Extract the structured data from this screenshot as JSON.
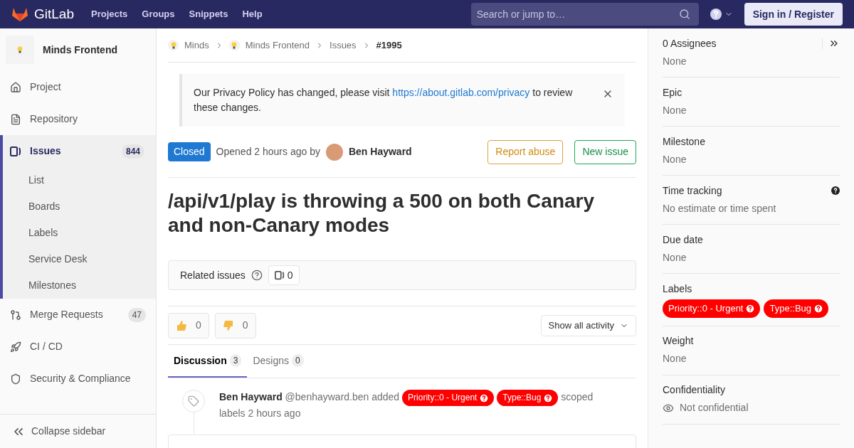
{
  "header": {
    "brand": "GitLab",
    "nav": [
      "Projects",
      "Groups",
      "Snippets",
      "Help"
    ],
    "search": {
      "placeholder": "Search or jump to…"
    },
    "sign_in": "Sign in / Register"
  },
  "sidebar": {
    "project": "Minds Frontend",
    "items": [
      {
        "kind": "project",
        "label": "Project",
        "selected": false
      },
      {
        "kind": "repository",
        "label": "Repository",
        "selected": false
      },
      {
        "kind": "issues",
        "label": "Issues",
        "count": "844",
        "selected": true,
        "children": [
          {
            "label": "List"
          },
          {
            "label": "Boards"
          },
          {
            "label": "Labels"
          },
          {
            "label": "Service Desk"
          },
          {
            "label": "Milestones"
          }
        ]
      },
      {
        "kind": "merge",
        "label": "Merge Requests",
        "count": "47",
        "selected": false
      },
      {
        "kind": "cicd",
        "label": "CI / CD",
        "selected": false
      },
      {
        "kind": "security",
        "label": "Security & Compliance",
        "selected": false
      }
    ],
    "collapse": "Collapse sidebar"
  },
  "breadcrumbs": [
    {
      "label": "Minds",
      "kind": "project"
    },
    {
      "label": "Minds Frontend",
      "kind": "project"
    },
    {
      "label": "Issues",
      "kind": "plain"
    },
    {
      "label": "#1995",
      "kind": "current"
    }
  ],
  "notice": {
    "text": "Our Privacy Policy has changed, please visit",
    "link": "https://about.gitlab.com/privacy",
    "after": "to review these changes."
  },
  "issue": {
    "status": "Closed",
    "opened": "Opened 2 hours ago by",
    "author": "Ben Hayward",
    "buttons": [
      "Report abuse",
      "New issue"
    ],
    "title": "/api/v1/play is throwing a 500 on both Canary and non-Canary modes"
  },
  "related": {
    "label": "Related issues",
    "count": "0"
  },
  "reactions": [
    {
      "kind": "up",
      "count": "0"
    },
    {
      "kind": "down",
      "count": "0"
    }
  ],
  "activity_filter": "Show all activity",
  "tabs": [
    {
      "label": "Discussion",
      "count": "3",
      "selected": true
    },
    {
      "label": "Designs",
      "count": "0",
      "selected": false
    }
  ],
  "note": {
    "author": "Ben Hayward",
    "handle": "@benhayward.ben added",
    "labels": [
      {
        "label": "Priority::0 - Urgent",
        "color": "#ff0000"
      },
      {
        "label": "Type::Bug",
        "color": "#ff0000"
      }
    ],
    "after": "scoped labels 2 hours ago"
  },
  "right_sidebar": [
    {
      "title": "0 Assignees",
      "value": "None",
      "kind": "assignees"
    },
    {
      "title": "Epic",
      "value": "None",
      "kind": "plain"
    },
    {
      "title": "Milestone",
      "value": "None",
      "kind": "plain"
    },
    {
      "title": "Time tracking",
      "value": "No estimate or time spent",
      "kind": "help"
    },
    {
      "title": "Due date",
      "value": "None",
      "kind": "plain"
    },
    {
      "title": "Labels",
      "kind": "labels",
      "labels": [
        {
          "label": "Priority::0 - Urgent",
          "color": "#ff0000"
        },
        {
          "label": "Type::Bug",
          "color": "#ff0000"
        }
      ]
    },
    {
      "title": "Weight",
      "value": "None",
      "kind": "plain"
    },
    {
      "title": "Confidentiality",
      "value": "Not confidential",
      "kind": "confidential"
    }
  ]
}
